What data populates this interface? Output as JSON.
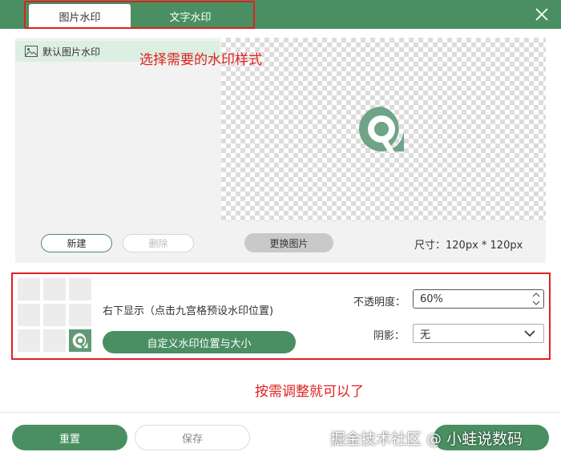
{
  "tabs": [
    {
      "label": "图片水印",
      "active": true
    },
    {
      "label": "文字水印",
      "active": false
    }
  ],
  "watermark_list": {
    "items": [
      {
        "label": "默认图片水印",
        "icon": "image-icon",
        "selected": true
      }
    ]
  },
  "annotations": {
    "select_style": "选择需要的水印样式",
    "adjust": "按需调整就可以了"
  },
  "actions": {
    "new_label": "新建",
    "delete_label": "删除",
    "change_image_label": "更换图片"
  },
  "size_label": "尺寸：120px * 120px",
  "position": {
    "text": "右下显示（点击九宫格预设水印位置)",
    "selected_cell": 8,
    "custom_button_label": "自定义水印位置与大小"
  },
  "opacity": {
    "label": "不透明度：",
    "value": "60%"
  },
  "shadow": {
    "label": "阴影：",
    "value": "无"
  },
  "footer": {
    "reset_label": "重置",
    "save_label": "保存"
  },
  "site_watermark": "掘金技术社区 @ 小蛙说数码",
  "colors": {
    "accent": "#4a8f62",
    "highlight": "#e02020",
    "selected_row": "#dcefe2"
  }
}
